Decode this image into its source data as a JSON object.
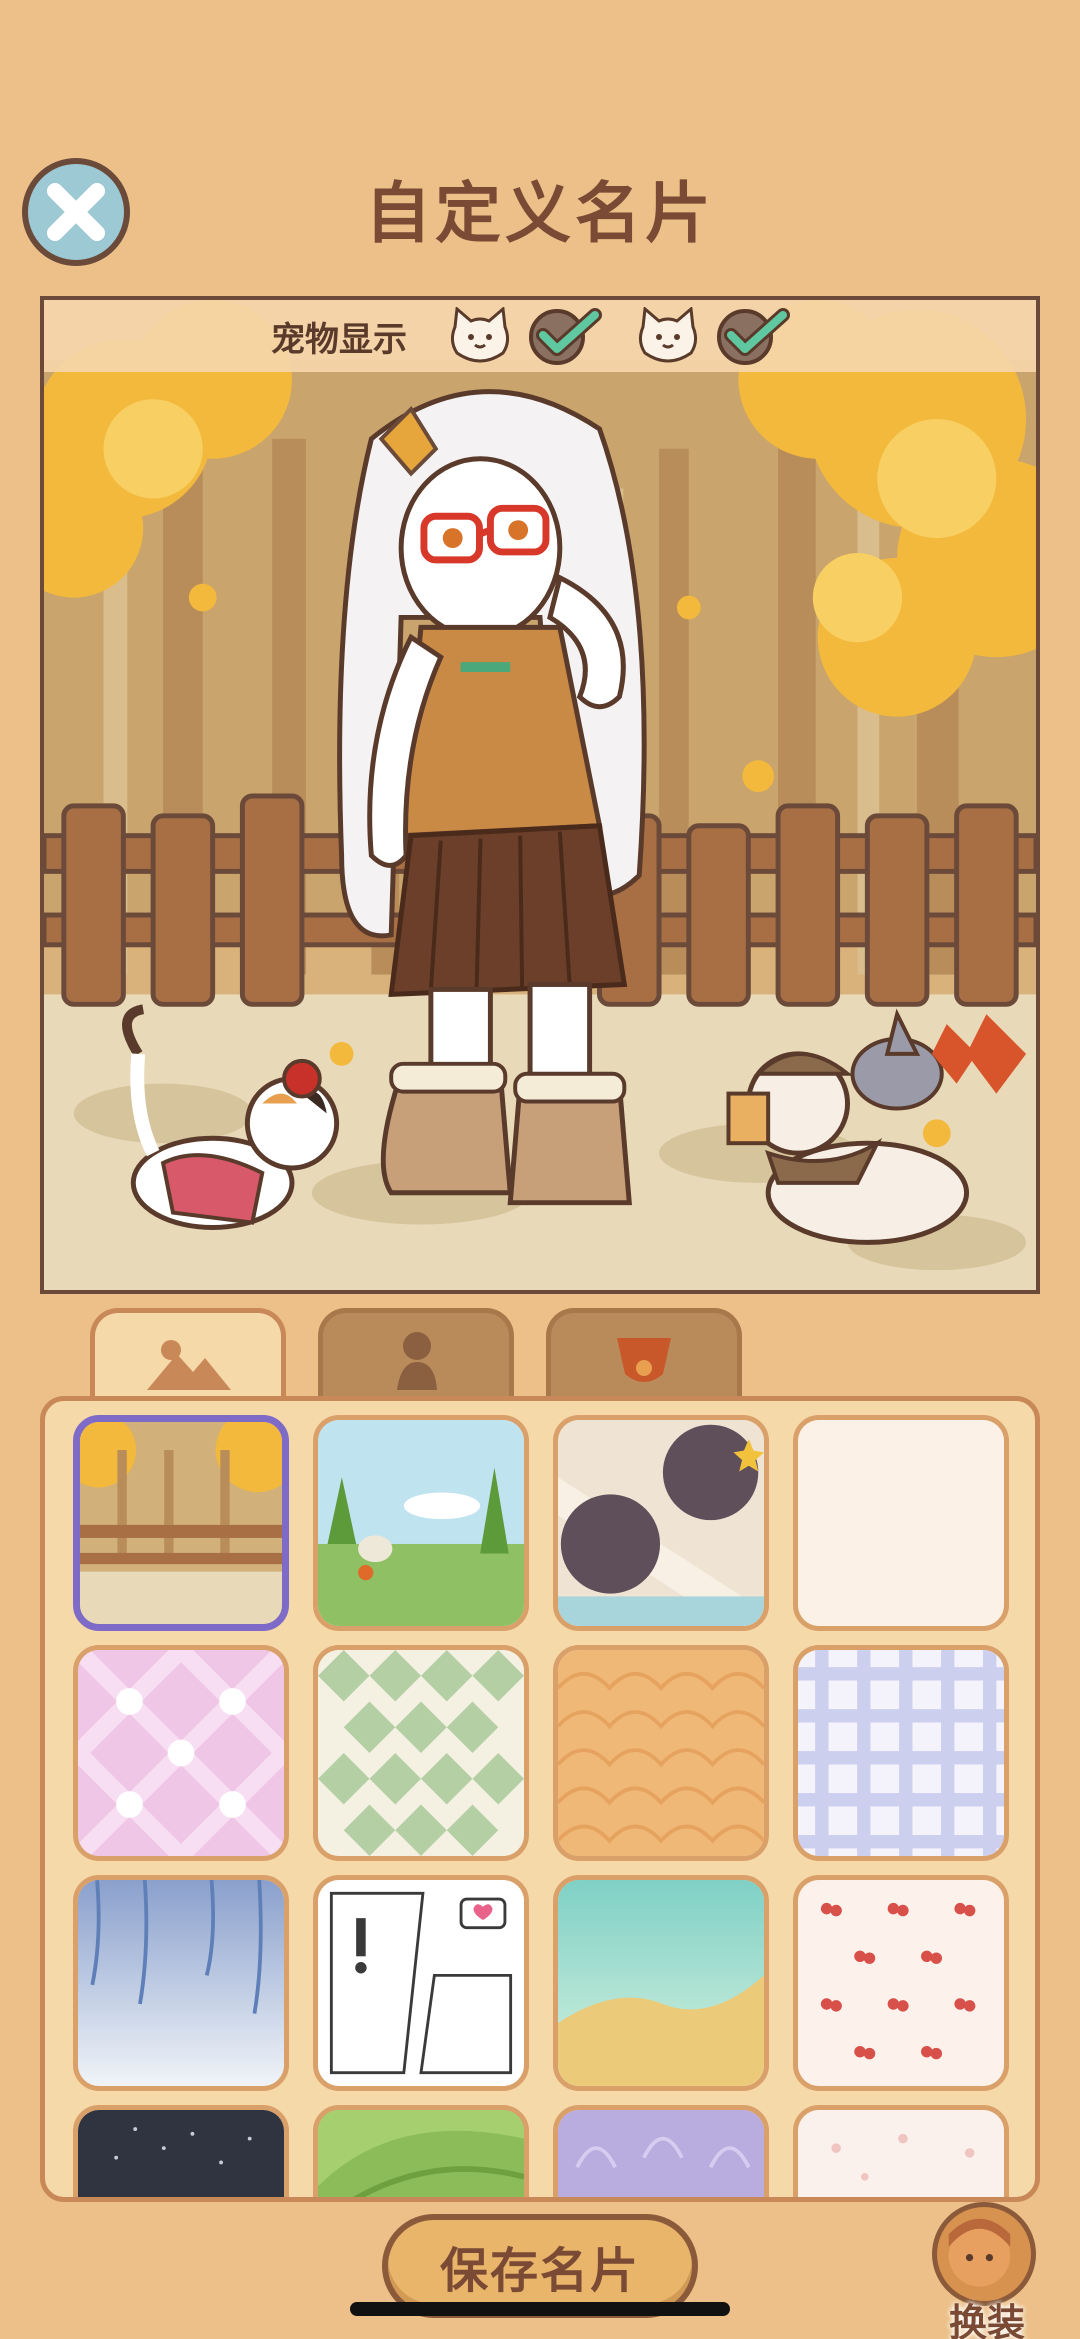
{
  "header": {
    "title": "自定义名片",
    "close_icon": "close-icon"
  },
  "preview": {
    "pet_display_label": "宠物显示",
    "pets": [
      {
        "icon": "cat-face-icon",
        "checked": true
      },
      {
        "icon": "cat-face-icon",
        "checked": true
      }
    ]
  },
  "tabs": [
    {
      "icon": "background-mountain-icon",
      "active": true
    },
    {
      "icon": "character-pose-icon",
      "active": false
    },
    {
      "icon": "pet-collar-icon",
      "active": false
    }
  ],
  "backgrounds": [
    {
      "name": "autumn-forest",
      "selected": true
    },
    {
      "name": "farm-field",
      "selected": false
    },
    {
      "name": "polka-stars",
      "selected": false
    },
    {
      "name": "plain-cream",
      "selected": false
    },
    {
      "name": "pink-hearts",
      "selected": false
    },
    {
      "name": "green-diamonds",
      "selected": false
    },
    {
      "name": "orange-waves",
      "selected": false
    },
    {
      "name": "blue-gingham",
      "selected": false
    },
    {
      "name": "wisteria-sky",
      "selected": false
    },
    {
      "name": "manga-panels",
      "selected": false
    },
    {
      "name": "beach-sea",
      "selected": false
    },
    {
      "name": "cherry-pattern",
      "selected": false
    },
    {
      "name": "night-sparkle",
      "selected": false
    },
    {
      "name": "green-hills",
      "selected": false
    },
    {
      "name": "lavender-leaves",
      "selected": false
    },
    {
      "name": "floral-cream",
      "selected": false
    }
  ],
  "footer": {
    "save_label": "保存名片",
    "dress_label": "换装"
  },
  "colors": {
    "background": "#ecc088",
    "title": "#7a4a35",
    "selected_border": "#7d6bc7",
    "check_green": "#5fc8a0"
  }
}
